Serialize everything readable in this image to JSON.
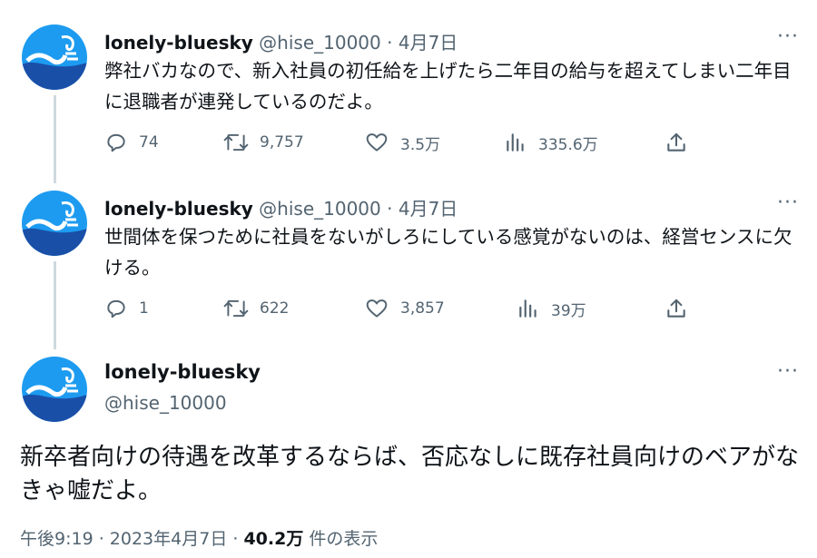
{
  "tweets": [
    {
      "name": "lonely-bluesky",
      "handle": "@hise_10000",
      "sep": "·",
      "date": "4月7日",
      "text": "弊社バカなので、新入社員の初任給を上げたら二年目の給与を超えてしまい二年目に退職者が連発しているのだよ。",
      "replies": "74",
      "retweets": "9,757",
      "likes": "3.5万",
      "views": "335.6万"
    },
    {
      "name": "lonely-bluesky",
      "handle": "@hise_10000",
      "sep": "·",
      "date": "4月7日",
      "text": "世間体を保つために社員をないがしろにしている感覚がないのは、経営センスに欠ける。",
      "replies": "1",
      "retweets": "622",
      "likes": "3,857",
      "views": "39万"
    }
  ],
  "main": {
    "name": "lonely-bluesky",
    "handle": "@hise_10000",
    "text": "新卒者向けの待遇を改革するならば、否応なしに既存社員向けのベアがなきゃ嘘だよ。",
    "time": "午後9:19 · 2023年4月7日 · ",
    "views_count": "40.2万",
    "views_label": " 件の表示"
  },
  "more_glyph": "···",
  "colors": {
    "muted": "#536471",
    "text": "#0f1419",
    "line": "#cfd9de",
    "avatar_blue": "#1d9bf0",
    "avatar_navy": "#1a4fa8"
  },
  "icons": [
    "reply-icon",
    "retweet-icon",
    "like-icon",
    "views-icon",
    "share-icon",
    "more-icon",
    "avatar-logo-icon"
  ]
}
